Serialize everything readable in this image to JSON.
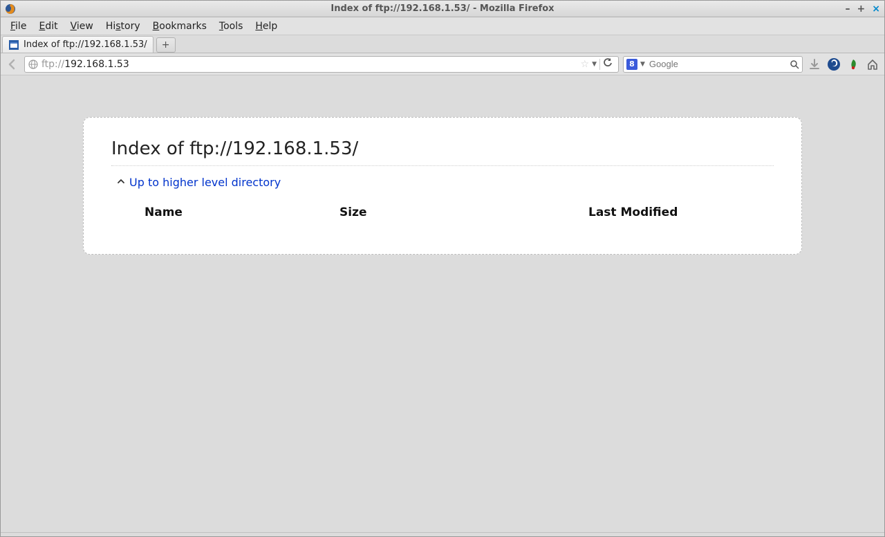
{
  "window": {
    "title": "Index of ftp://192.168.1.53/ - Mozilla Firefox"
  },
  "menu": [
    "File",
    "Edit",
    "View",
    "History",
    "Bookmarks",
    "Tools",
    "Help"
  ],
  "tab": {
    "label": "Index of ftp://192.168.1.53/"
  },
  "url": {
    "protocol": "ftp://",
    "host": "192.168.1.53"
  },
  "search": {
    "engine_glyph": "8",
    "placeholder": "Google"
  },
  "page": {
    "heading": "Index of ftp://192.168.1.53/",
    "uplink": "Up to higher level directory",
    "columns": {
      "name": "Name",
      "size": "Size",
      "modified": "Last Modified"
    }
  }
}
